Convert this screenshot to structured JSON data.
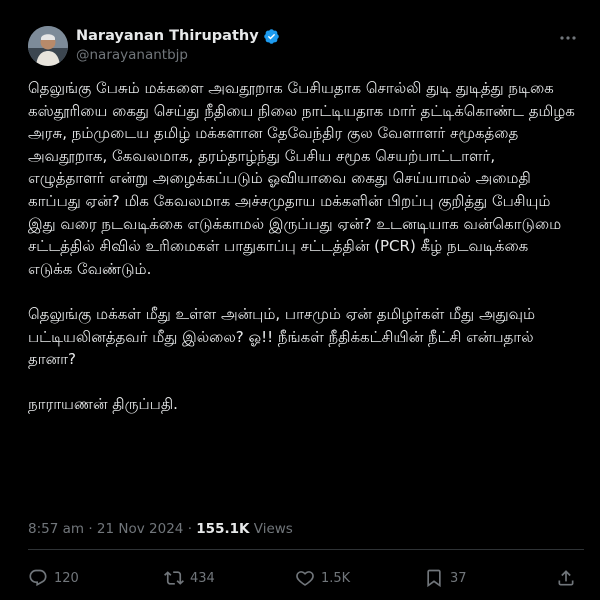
{
  "author": {
    "name": "Narayanan Thirupathy",
    "handle": "@narayanantbjp",
    "verified_color": "#1d9bf0"
  },
  "post": {
    "paragraphs": [
      "தெலுங்கு பேசும் மக்களை அவதூறாக பேசியதாக சொல்லி துடி துடித்து நடிகை கஸ்தூரியை கைது செய்து நீதியை நிலை நாட்டியதாக மார் தட்டிக்கொண்ட தமிழக அரசு, நம்முடைய தமிழ் மக்களான தேவேந்திர குல வேளாளர் சமூகத்தை அவதூறாக, கேவலமாக, தரம்தாழ்ந்து பேசிய சமூக செயற்பாட்டாளர், எழுத்தாளர் என்று அழைக்கப்படும் ஓவியாவை கைது செய்யாமல் அமைதி காப்பது ஏன்? மிக கேவலமாக அச்சமுதாய மக்களின் பிறப்பு குறித்து பேசியும் இது வரை நடவடிக்கை எடுக்காமல் இருப்பது ஏன்? உடனடியாக வன்கொடுமை சட்டத்தில் சிவில் உரிமைகள் பாதுகாப்பு சட்டத்தின் (PCR) கீழ் நடவடிக்கை எடுக்க வேண்டும்.",
      "தெலுங்கு மக்கள் மீது உள்ள அன்பும், பாசமும் ஏன் தமிழர்கள் மீது அதுவும் பட்டியலினத்தவர் மீது இல்லை? ஓ!! நீங்கள் நீதிக்கட்சியின் நீட்சி என்பதால் தானா?",
      "நாராயணன் திருப்பதி."
    ],
    "time": "8:57 am",
    "separator": "·",
    "date": "21 Nov 2024",
    "views_count": "155.1K",
    "views_label": "Views"
  },
  "actions": {
    "replies": "120",
    "reposts": "434",
    "likes": "1.5K",
    "bookmarks": "37"
  },
  "icons": [
    "verified-badge-icon",
    "more-icon",
    "reply-icon",
    "repost-icon",
    "like-icon",
    "bookmark-icon",
    "share-icon"
  ],
  "colors": {
    "background": "#000000",
    "text": "#e7e9ea",
    "muted": "#71767b",
    "accent": "#1d9bf0"
  }
}
